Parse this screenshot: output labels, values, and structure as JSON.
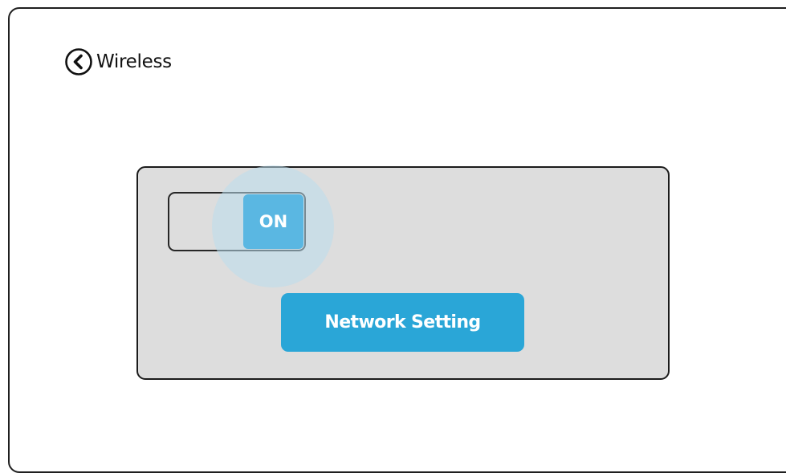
{
  "header": {
    "title": "Wireless",
    "back_icon": "chevron-left-circle-icon"
  },
  "wireless_toggle": {
    "label": "ON",
    "state": "on",
    "accent_color": "#5ab7e2"
  },
  "network_setting": {
    "label": "Network Setting",
    "color": "#2aa6d7"
  },
  "panel": {
    "background": "#dddddd"
  }
}
